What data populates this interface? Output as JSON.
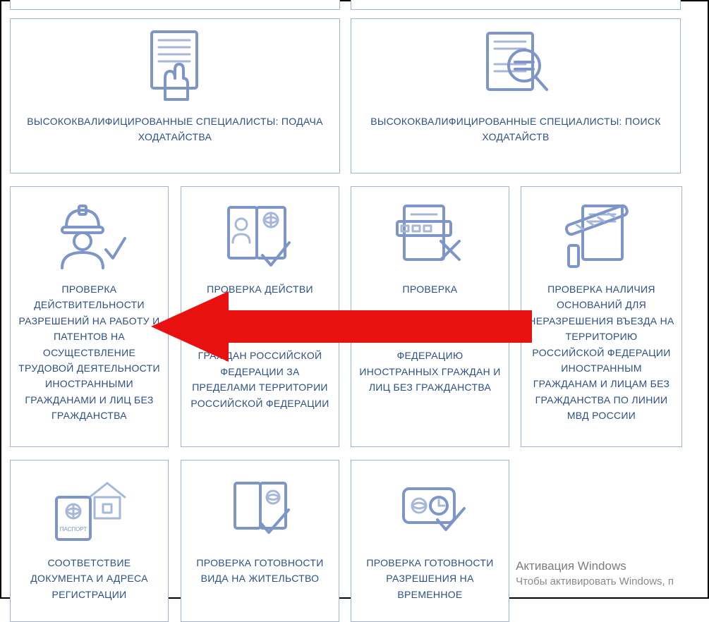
{
  "cards": {
    "top_clip_left": "",
    "top_clip_right": "",
    "wide_left": "ВЫСОКОКВАЛИФИЦИРОВАННЫЕ СПЕЦИАЛИСТЫ: ПОДАЧА ХОДАТАЙСТВА",
    "wide_right": "ВЫСОКОКВАЛИФИЦИРОВАННЫЕ СПЕЦИАЛИСТЫ: ПОИСК ХОДАТАЙСТВ",
    "mid_1": "ПРОВЕРКА ДЕЙСТВИТЕЛЬНОСТИ РАЗРЕШЕНИЙ НА РАБОТУ И ПАТЕНТОВ НА ОСУЩЕСТВЛЕНИЕ ТРУДОВОЙ ДЕЯТЕЛЬНОСТИ ИНОСТРАННЫМИ ГРАЖДАНАМИ И ЛИЦ БЕЗ ГРАЖДАНСТВА",
    "mid_2_a": "ПРОВЕРКА ДЕЙСТВИ",
    "mid_2_b": "ГРАЖДАН РОССИЙСКОЙ ФЕДЕРАЦИИ ЗА ПРЕДЕЛАМИ ТЕРРИТОРИИ РОССИЙСКОЙ ФЕДЕРАЦИИ",
    "mid_3_a": "ПРОВЕРКА",
    "mid_3_b": "ФЕДЕРАЦИЮ ИНОСТРАННЫХ ГРАЖДАН И ЛИЦ БЕЗ ГРАЖДАНСТВА",
    "mid_4": "ПРОВЕРКА НАЛИЧИЯ ОСНОВАНИЙ ДЛЯ НЕРАЗРЕШЕНИЯ ВЪЕЗДА НА ТЕРРИТОРИЮ РОССИЙСКОЙ ФЕДЕРАЦИИ ИНОСТРАННЫМ ГРАЖДАНАМ И ЛИЦАМ БЕЗ ГРАЖДАНСТВА ПО ЛИНИИ МВД РОССИИ",
    "bot_1": "СООТВЕТСТВИЕ ДОКУМЕНТА И АДРЕСА РЕГИСТРАЦИИ",
    "bot_2": "ПРОВЕРКА ГОТОВНОСТИ ВИДА НА ЖИТЕЛЬСТВО",
    "bot_3": "ПРОВЕРКА ГОТОВНОСТИ РАЗРЕШЕНИЯ НА ВРЕМЕННОЕ"
  },
  "passport_label": "ПАСПОРТ",
  "watermark": {
    "title": "Активация Windows",
    "sub": "Чтобы активировать Windows, п"
  }
}
